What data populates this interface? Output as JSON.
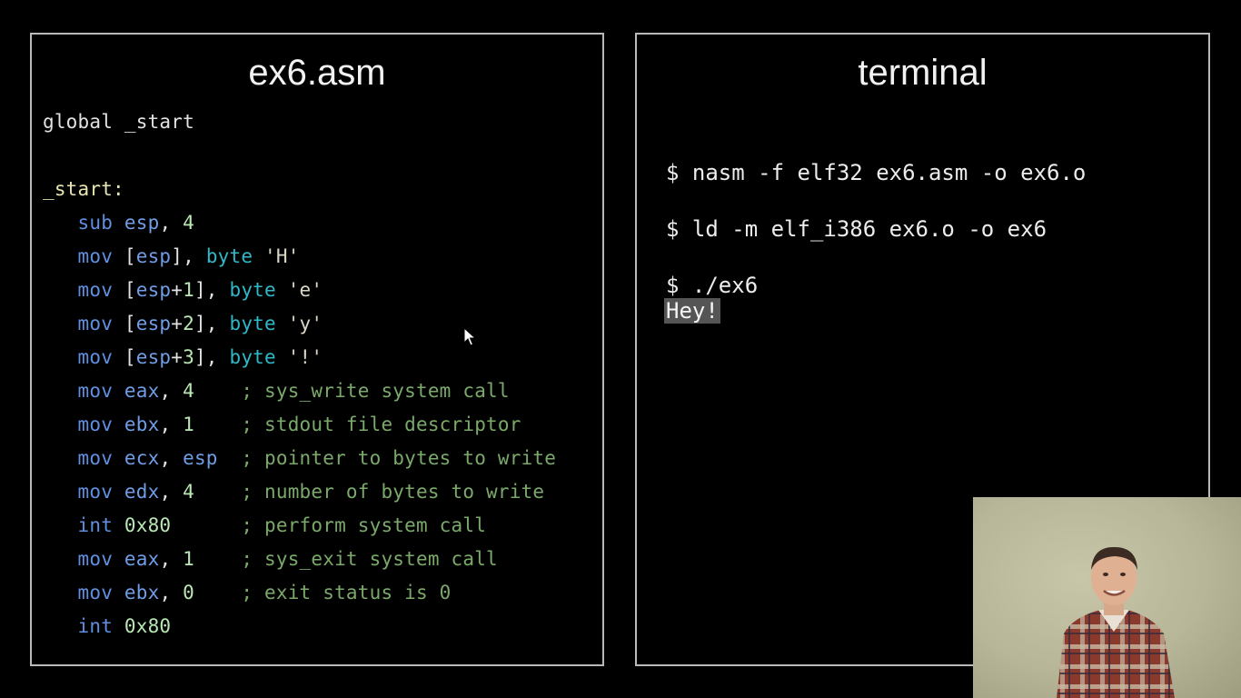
{
  "editor": {
    "title": "ex6.asm",
    "lines": [
      [
        {
          "t": "global _start",
          "c": "plain"
        }
      ],
      [],
      [
        {
          "t": "_start:",
          "c": "label"
        }
      ],
      [
        {
          "t": "   ",
          "c": "plain"
        },
        {
          "t": "sub",
          "c": "kw"
        },
        {
          "t": " ",
          "c": "plain"
        },
        {
          "t": "esp",
          "c": "reg"
        },
        {
          "t": ", ",
          "c": "plain"
        },
        {
          "t": "4",
          "c": "num"
        }
      ],
      [
        {
          "t": "   ",
          "c": "plain"
        },
        {
          "t": "mov",
          "c": "kw"
        },
        {
          "t": " [",
          "c": "plain"
        },
        {
          "t": "esp",
          "c": "reg"
        },
        {
          "t": "], ",
          "c": "plain"
        },
        {
          "t": "byte",
          "c": "type"
        },
        {
          "t": " 'H'",
          "c": "str"
        }
      ],
      [
        {
          "t": "   ",
          "c": "plain"
        },
        {
          "t": "mov",
          "c": "kw"
        },
        {
          "t": " [",
          "c": "plain"
        },
        {
          "t": "esp",
          "c": "reg"
        },
        {
          "t": "+",
          "c": "plain"
        },
        {
          "t": "1",
          "c": "num"
        },
        {
          "t": "], ",
          "c": "plain"
        },
        {
          "t": "byte",
          "c": "type"
        },
        {
          "t": " 'e'",
          "c": "str"
        }
      ],
      [
        {
          "t": "   ",
          "c": "plain"
        },
        {
          "t": "mov",
          "c": "kw"
        },
        {
          "t": " [",
          "c": "plain"
        },
        {
          "t": "esp",
          "c": "reg"
        },
        {
          "t": "+",
          "c": "plain"
        },
        {
          "t": "2",
          "c": "num"
        },
        {
          "t": "], ",
          "c": "plain"
        },
        {
          "t": "byte",
          "c": "type"
        },
        {
          "t": " 'y'",
          "c": "str"
        }
      ],
      [
        {
          "t": "   ",
          "c": "plain"
        },
        {
          "t": "mov",
          "c": "kw"
        },
        {
          "t": " [",
          "c": "plain"
        },
        {
          "t": "esp",
          "c": "reg"
        },
        {
          "t": "+",
          "c": "plain"
        },
        {
          "t": "3",
          "c": "num"
        },
        {
          "t": "], ",
          "c": "plain"
        },
        {
          "t": "byte",
          "c": "type"
        },
        {
          "t": " '!'",
          "c": "str"
        }
      ],
      [
        {
          "t": "   ",
          "c": "plain"
        },
        {
          "t": "mov",
          "c": "kw"
        },
        {
          "t": " ",
          "c": "plain"
        },
        {
          "t": "eax",
          "c": "reg"
        },
        {
          "t": ", ",
          "c": "plain"
        },
        {
          "t": "4",
          "c": "num"
        },
        {
          "t": "    ",
          "c": "plain"
        },
        {
          "t": "; sys_write system call",
          "c": "cmt"
        }
      ],
      [
        {
          "t": "   ",
          "c": "plain"
        },
        {
          "t": "mov",
          "c": "kw"
        },
        {
          "t": " ",
          "c": "plain"
        },
        {
          "t": "ebx",
          "c": "reg"
        },
        {
          "t": ", ",
          "c": "plain"
        },
        {
          "t": "1",
          "c": "num"
        },
        {
          "t": "    ",
          "c": "plain"
        },
        {
          "t": "; stdout file descriptor",
          "c": "cmt"
        }
      ],
      [
        {
          "t": "   ",
          "c": "plain"
        },
        {
          "t": "mov",
          "c": "kw"
        },
        {
          "t": " ",
          "c": "plain"
        },
        {
          "t": "ecx",
          "c": "reg"
        },
        {
          "t": ", ",
          "c": "plain"
        },
        {
          "t": "esp",
          "c": "reg"
        },
        {
          "t": "  ",
          "c": "plain"
        },
        {
          "t": "; pointer to bytes to write",
          "c": "cmt"
        }
      ],
      [
        {
          "t": "   ",
          "c": "plain"
        },
        {
          "t": "mov",
          "c": "kw"
        },
        {
          "t": " ",
          "c": "plain"
        },
        {
          "t": "edx",
          "c": "reg"
        },
        {
          "t": ", ",
          "c": "plain"
        },
        {
          "t": "4",
          "c": "num"
        },
        {
          "t": "    ",
          "c": "plain"
        },
        {
          "t": "; number of bytes to write",
          "c": "cmt"
        }
      ],
      [
        {
          "t": "   ",
          "c": "plain"
        },
        {
          "t": "int",
          "c": "kw"
        },
        {
          "t": " ",
          "c": "plain"
        },
        {
          "t": "0x80",
          "c": "num"
        },
        {
          "t": "      ",
          "c": "plain"
        },
        {
          "t": "; perform system call",
          "c": "cmt"
        }
      ],
      [
        {
          "t": "   ",
          "c": "plain"
        },
        {
          "t": "mov",
          "c": "kw"
        },
        {
          "t": " ",
          "c": "plain"
        },
        {
          "t": "eax",
          "c": "reg"
        },
        {
          "t": ", ",
          "c": "plain"
        },
        {
          "t": "1",
          "c": "num"
        },
        {
          "t": "    ",
          "c": "plain"
        },
        {
          "t": "; sys_exit system call",
          "c": "cmt"
        }
      ],
      [
        {
          "t": "   ",
          "c": "plain"
        },
        {
          "t": "mov",
          "c": "kw"
        },
        {
          "t": " ",
          "c": "plain"
        },
        {
          "t": "ebx",
          "c": "reg"
        },
        {
          "t": ", ",
          "c": "plain"
        },
        {
          "t": "0",
          "c": "num"
        },
        {
          "t": "    ",
          "c": "plain"
        },
        {
          "t": "; exit status is 0",
          "c": "cmt"
        }
      ],
      [
        {
          "t": "   ",
          "c": "plain"
        },
        {
          "t": "int",
          "c": "kw"
        },
        {
          "t": " ",
          "c": "plain"
        },
        {
          "t": "0x80",
          "c": "num"
        }
      ]
    ]
  },
  "terminal": {
    "title": "terminal",
    "cmd1": "$ nasm -f elf32 ex6.asm -o ex6.o",
    "cmd2": "$ ld -m elf_i386 ex6.o -o ex6",
    "cmd3": "$ ./ex6",
    "output": "Hey!"
  },
  "colors": {
    "keyword": "#5f8fe0",
    "register": "#6f9de6",
    "type": "#2fb8c8",
    "comment": "#7aa96a",
    "number": "#b9e8b4",
    "label": "#e8e6b0",
    "panel_border": "#b9b9b9",
    "output_highlight": "#555555"
  },
  "icons": {
    "cursor": "mouse-pointer-icon"
  }
}
